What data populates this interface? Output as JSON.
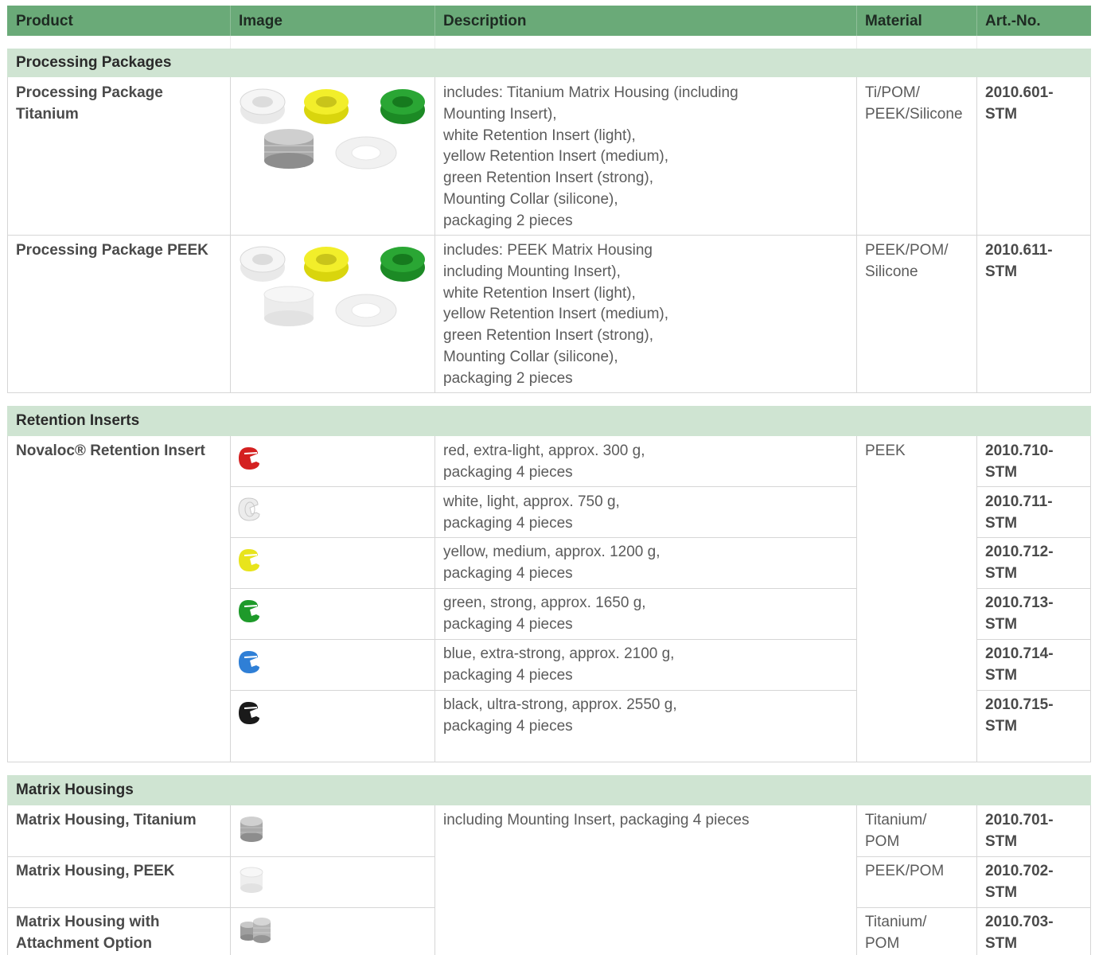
{
  "header": {
    "product": "Product",
    "image": "Image",
    "description": "Description",
    "material": "Material",
    "artno": "Art.-No."
  },
  "sections": {
    "processing": {
      "title": "Processing Packages",
      "rows": [
        {
          "product": "Processing Package\nTitanium",
          "description": "includes: Titanium Matrix Housing (including\nMounting Insert),\nwhite Retention Insert (light),\nyellow Retention Insert (medium),\ngreen Retention Insert (strong),\nMounting Collar (silicone),\npackaging 2 pieces",
          "material": "Ti/POM/\nPEEK/Silicone",
          "artno": "2010.601-\nSTM",
          "image_icons": [
            "white-ring-icon",
            "yellow-ring-icon",
            "green-ring-icon",
            "titanium-housing-icon",
            "mounting-collar-icon"
          ]
        },
        {
          "product": "Processing Package PEEK",
          "description": "includes: PEEK Matrix Housing\nincluding Mounting Insert),\nwhite Retention Insert (light),\nyellow Retention Insert (medium),\ngreen Retention Insert (strong),\nMounting Collar (silicone),\npackaging 2 pieces",
          "material": "PEEK/POM/\nSilicone",
          "artno": "2010.611-\nSTM",
          "image_icons": [
            "white-ring-icon",
            "yellow-ring-icon",
            "green-ring-icon",
            "peek-housing-icon",
            "mounting-collar-icon"
          ]
        }
      ]
    },
    "retention": {
      "title": "Retention Inserts",
      "product": "Novaloc® Retention Insert",
      "material": "PEEK",
      "rows": [
        {
          "description": "red, extra-light, approx. 300 g,\npackaging 4 pieces",
          "artno": "2010.710-\nSTM",
          "color": "#d42020"
        },
        {
          "description": "white, light, approx. 750 g,\npackaging 4 pieces",
          "artno": "2010.711-\nSTM",
          "color": "#e6e6e6"
        },
        {
          "description": "yellow, medium, approx. 1200 g,\npackaging 4 pieces",
          "artno": "2010.712-\nSTM",
          "color": "#e8e41c"
        },
        {
          "description": "green, strong, approx. 1650 g,\npackaging 4 pieces",
          "artno": "2010.713-\nSTM",
          "color": "#1e9a2a"
        },
        {
          "description": "blue, extra-strong, approx. 2100 g,\npackaging 4 pieces",
          "artno": "2010.714-\nSTM",
          "color": "#2f7fd6"
        },
        {
          "description": "black, ultra-strong, approx. 2550 g,\npackaging 4 pieces",
          "artno": "2010.715-\nSTM",
          "color": "#1a1a1a"
        }
      ]
    },
    "matrix": {
      "title": "Matrix Housings",
      "description": "including Mounting Insert, packaging 4 pieces",
      "rows": [
        {
          "product": "Matrix Housing, Titanium",
          "material": "Titanium/\nPOM",
          "artno": "2010.701-\nSTM"
        },
        {
          "product": "Matrix Housing, PEEK",
          "material": "PEEK/POM",
          "artno": "2010.702-\nSTM"
        },
        {
          "product": "Matrix Housing with\nAttachment Option",
          "material": "Titanium/\nPOM",
          "artno": "2010.703-\nSTM"
        }
      ]
    }
  },
  "colors": {
    "header_bg": "#6aaa78",
    "section_bg": "#cfe4d2",
    "border": "#d6d6d6"
  }
}
